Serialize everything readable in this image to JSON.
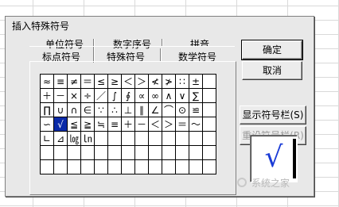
{
  "dialog": {
    "title": "插入特殊符号"
  },
  "tabs": {
    "row1": [
      "单位符号",
      "数字序号",
      "拼音"
    ],
    "row2": [
      "标点符号",
      "特殊符号",
      "数学符号"
    ],
    "active": "数学符号"
  },
  "symbols": [
    "≈",
    "≡",
    "≠",
    "＝",
    "≤",
    "≥",
    "＜",
    "＞",
    "≮",
    "≯",
    "∷",
    "±",
    "",
    "＋",
    "－",
    "×",
    "÷",
    "／",
    "∫",
    "∮",
    "∝",
    "∞",
    "∧",
    "∨",
    "∑",
    "",
    "∏",
    "∪",
    "∩",
    "∈",
    "∵",
    "∴",
    "⊥",
    "∥",
    "∠",
    "⌒",
    "⊙",
    "≌",
    "",
    "∽",
    "√",
    "≦",
    "≧",
    "≒",
    "≡",
    "＋",
    "－",
    "＜",
    "＞",
    "＝",
    "～",
    "",
    "∟",
    "⊿",
    "㏒",
    "㏑",
    "",
    "",
    "",
    "",
    "",
    "",
    "",
    "",
    "",
    "",
    "",
    "",
    "",
    "",
    "",
    "",
    "",
    "",
    "",
    "",
    "",
    "",
    "",
    "",
    "",
    "",
    "",
    "",
    "",
    "",
    "",
    "",
    "",
    "",
    ""
  ],
  "selected_symbol": "√",
  "buttons": {
    "ok": "确定",
    "cancel": "取消",
    "show_toolbar": "显示符号栏(S)",
    "reset_toolbar": "重设符号栏(R)"
  },
  "preview": {
    "symbol": "√"
  },
  "watermark": "系统之家"
}
